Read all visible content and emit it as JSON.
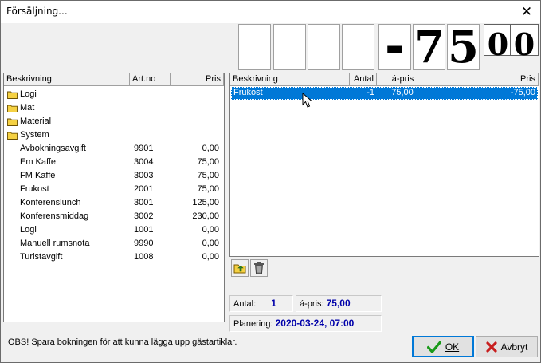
{
  "window": {
    "title": "Försäljning..."
  },
  "display": {
    "digits": [
      "",
      "",
      "",
      "",
      "-",
      "7",
      "5",
      "0",
      "0"
    ]
  },
  "left_table": {
    "headers": [
      "Beskrivning",
      "Art.no",
      "Pris"
    ],
    "folders": [
      "Logi",
      "Mat",
      "Material",
      "System"
    ],
    "items": [
      {
        "name": "Avbokningsavgift",
        "artno": "9901",
        "price": "0,00"
      },
      {
        "name": "Em Kaffe",
        "artno": "3004",
        "price": "75,00"
      },
      {
        "name": "FM Kaffe",
        "artno": "3003",
        "price": "75,00"
      },
      {
        "name": "Frukost",
        "artno": "2001",
        "price": "75,00"
      },
      {
        "name": "Konferenslunch",
        "artno": "3001",
        "price": "125,00"
      },
      {
        "name": "Konferensmiddag",
        "artno": "3002",
        "price": "230,00"
      },
      {
        "name": "Logi",
        "artno": "1001",
        "price": "0,00"
      },
      {
        "name": "Manuell rumsnota",
        "artno": "9990",
        "price": "0,00"
      },
      {
        "name": "Turistavgift",
        "artno": "1008",
        "price": "0,00"
      }
    ]
  },
  "right_table": {
    "headers": [
      "Beskrivning",
      "Antal",
      "á-pris",
      "Pris"
    ],
    "rows": [
      {
        "name": "Frukost",
        "antal": "-1",
        "apris": "75,00",
        "pris": "-75,00"
      }
    ]
  },
  "info": {
    "antal_label": "Antal:",
    "antal_value": "1",
    "apris_label": "á-pris:",
    "apris_value": "75,00",
    "planering_label": "Planering:",
    "planering_value": "2020-03-24, 07:00"
  },
  "footer": {
    "notice": "OBS! Spara bokningen för att kunna lägga upp gästartiklar.",
    "ok_label": "OK",
    "cancel_label": "Avbryt"
  },
  "colors": {
    "selection": "#0078d7",
    "value_text": "#0000aa",
    "ok_check": "#1a9a1a",
    "cancel_x": "#c81e1e"
  }
}
